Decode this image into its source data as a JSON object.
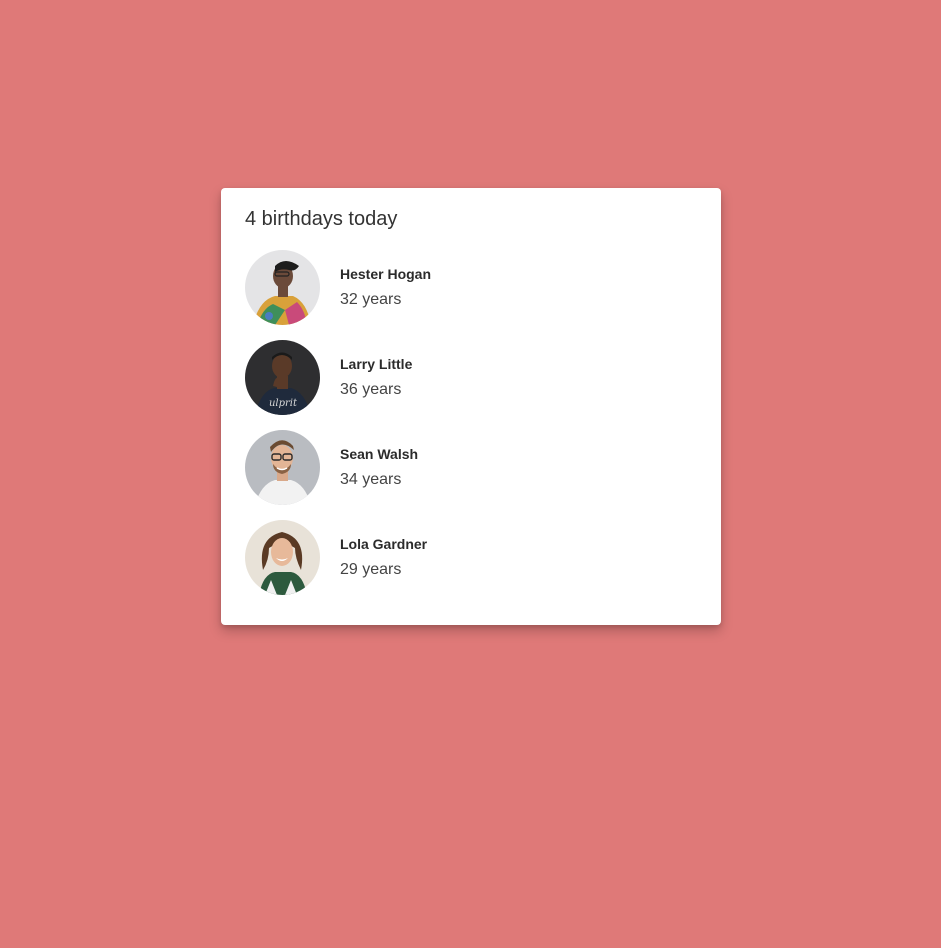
{
  "background_color": "#df7978",
  "card": {
    "title": "4 birthdays today",
    "people": [
      {
        "name": "Hester Hogan",
        "age": "32 years",
        "avatar_icon": "person-photo-icon"
      },
      {
        "name": "Larry Little",
        "age": "36 years",
        "avatar_icon": "person-photo-icon"
      },
      {
        "name": "Sean Walsh",
        "age": "34 years",
        "avatar_icon": "person-photo-icon"
      },
      {
        "name": "Lola Gardner",
        "age": "29 years",
        "avatar_icon": "person-photo-icon"
      }
    ]
  }
}
